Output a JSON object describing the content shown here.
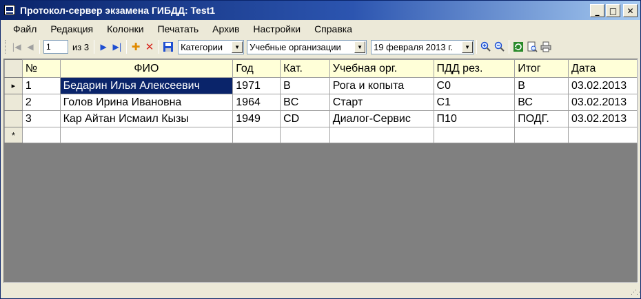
{
  "window": {
    "title": "Протокол-сервер экзамена ГИБДД: Test1",
    "minimize": "_",
    "maximize": "□",
    "close": "✕"
  },
  "menu": [
    "Файл",
    "Редакция",
    "Колонки",
    "Печатать",
    "Архив",
    "Настройки",
    "Справка"
  ],
  "toolbar": {
    "position_value": "1",
    "of_text": "из 3",
    "category_filter": "Категории",
    "org_filter": "Учебные организации",
    "date_filter": "19 февраля 2013 г."
  },
  "table": {
    "columns": [
      "№",
      "ФИО",
      "Год",
      "Кат.",
      "Учебная орг.",
      "ПДД рез.",
      "Итог",
      "Дата"
    ],
    "rows": [
      [
        "1",
        "Бедарин Илья Алексеевич",
        "1971",
        "B",
        "Рога и копыта",
        "С0",
        "В",
        "03.02.2013"
      ],
      [
        "2",
        "Голов Ирина Ивановна",
        "1964",
        "BC",
        "Старт",
        "С1",
        "ВС",
        "03.02.2013"
      ],
      [
        "3",
        "Кар Айтан Исмаил Кызы",
        "1949",
        "CD",
        "Диалог-Сервис",
        "П10",
        "ПОДГ.",
        "03.02.2013"
      ]
    ],
    "current_row_marker": "▸",
    "new_row_marker": "*"
  },
  "icons": {
    "first": "first-record-icon",
    "prev": "prev-record-icon",
    "next": "next-record-icon",
    "last": "last-record-icon",
    "add": "add-icon",
    "delete": "delete-icon",
    "save": "save-icon",
    "zoom_in": "zoom-in-icon",
    "zoom_out": "zoom-out-icon",
    "refresh": "refresh-icon",
    "preview": "print-preview-icon",
    "print": "print-icon"
  },
  "colors": {
    "titlebar": "#0a246a",
    "header_bg": "#ffffd8",
    "selection": "#0a246a",
    "empty_area": "#808080"
  }
}
